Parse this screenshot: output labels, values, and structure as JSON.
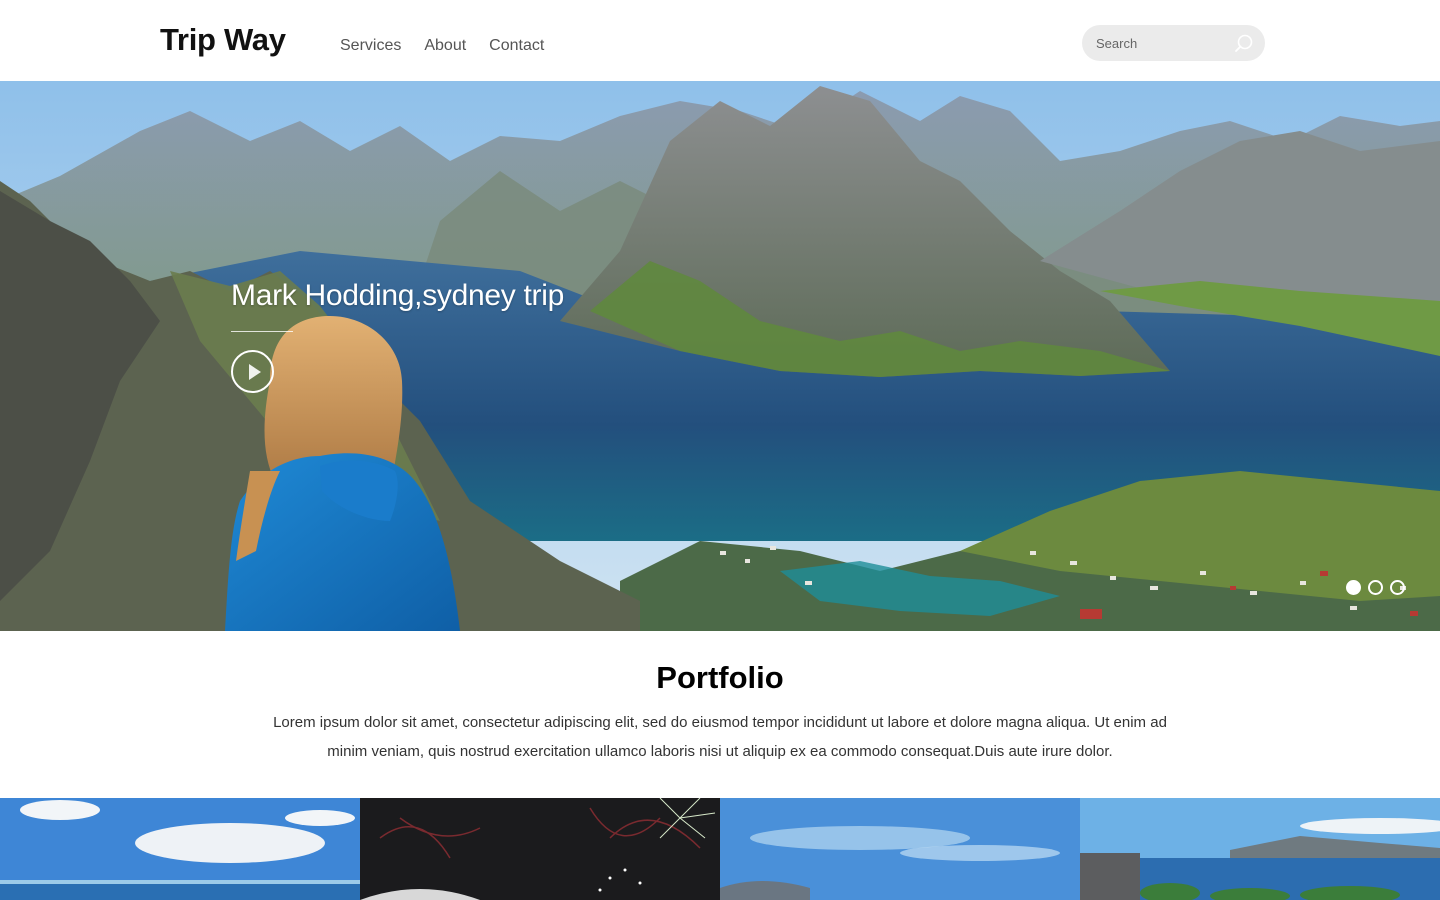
{
  "header": {
    "brand": "Trip Way",
    "nav": [
      {
        "label": "Services"
      },
      {
        "label": "About"
      },
      {
        "label": "Contact"
      }
    ],
    "search": {
      "placeholder": "Search",
      "icon": "search-icon"
    }
  },
  "hero": {
    "caption": "Mark Hodding,sydney trip",
    "play_icon": "play-icon",
    "slides": {
      "total": 3,
      "active": 1
    }
  },
  "portfolio": {
    "title": "Portfolio",
    "text": "Lorem ipsum dolor sit amet, consectetur adipiscing elit, sed do eiusmod tempor incididunt ut labore et dolore magna aliqua. Ut enim ad minim veniam, quis nostrud exercitation ullamco laboris nisi ut aliquip ex ea commodo consequat.Duis aute irure dolor."
  },
  "gallery": {
    "items": [
      {
        "subject": "sky-and-sea"
      },
      {
        "subject": "night-fireworks"
      },
      {
        "subject": "sky-and-dome"
      },
      {
        "subject": "coastal-city"
      }
    ]
  },
  "colors": {
    "search_bg": "#ebebeb",
    "nav_text": "#555555",
    "water": "#2b5f8c",
    "sky": "#a9cdea"
  }
}
